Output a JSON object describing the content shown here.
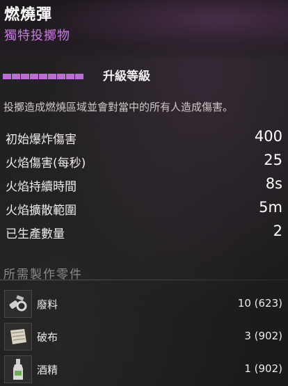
{
  "item": {
    "name": "燃燒彈",
    "type": "獨特投擲物"
  },
  "upgrade": {
    "label": "升級等級",
    "total_pips": 9,
    "filled_pips": 9
  },
  "description": "投擲造成燃燒區域並會對當中的所有人造成傷害。",
  "stats": [
    {
      "label": "初始爆炸傷害",
      "value": "400"
    },
    {
      "label": "火焰傷害(每秒)",
      "value": "25"
    },
    {
      "label": "火焰持續時間",
      "value": "8s"
    },
    {
      "label": "火焰擴散範圍",
      "value": "5m"
    },
    {
      "label": "已生產數量",
      "value": "2"
    }
  ],
  "materials_header": "所需製作零件",
  "materials": [
    {
      "name": "廢料",
      "count": "10 (623)",
      "icon": "scrap-icon"
    },
    {
      "name": "破布",
      "count": "3 (902)",
      "icon": "rag-icon"
    },
    {
      "name": "酒精",
      "count": "1 (902)",
      "icon": "alcohol-bottle-icon"
    }
  ],
  "colors": {
    "accent": "#c77de0",
    "pip": "#b86ed3",
    "text": "#efece9"
  }
}
